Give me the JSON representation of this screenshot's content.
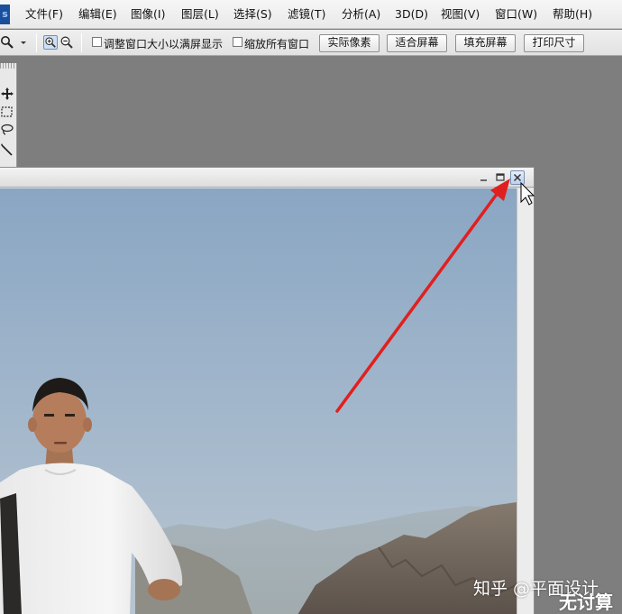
{
  "app": {
    "logo_text": "s"
  },
  "menu": {
    "items": [
      {
        "label": "文件(F)"
      },
      {
        "label": "编辑(E)"
      },
      {
        "label": "图像(I)"
      },
      {
        "label": "图层(L)"
      },
      {
        "label": "选择(S)"
      },
      {
        "label": "滤镜(T)"
      },
      {
        "label": "分析(A)"
      },
      {
        "label": "3D(D)"
      },
      {
        "label": "视图(V)"
      },
      {
        "label": "窗口(W)"
      },
      {
        "label": "帮助(H)"
      }
    ]
  },
  "options": {
    "resize_windows_label": "调整窗口大小以满屏显示",
    "zoom_all_windows_label": "缩放所有窗口",
    "actual_pixels_label": "实际像素",
    "fit_screen_label": "适合屏幕",
    "fill_screen_label": "填充屏幕",
    "print_size_label": "打印尺寸"
  },
  "icons": {
    "zoom_tool": "magnifier-icon",
    "zoom_in": "zoom-in-icon",
    "zoom_out": "zoom-out-icon",
    "move_tool": "move-icon",
    "marquee_tool": "marquee-icon",
    "lasso_tool": "lasso-icon",
    "magic_wand_tool": "magic-wand-icon",
    "minimize": "minimize-icon",
    "maximize": "maximize-icon",
    "close": "close-icon",
    "cursor": "mouse-pointer-icon"
  },
  "annotation": {
    "arrow_color": "#e0201f"
  },
  "watermark": {
    "zhihu_text": "知乎 @平面设计",
    "corner_text": "无讨算"
  }
}
